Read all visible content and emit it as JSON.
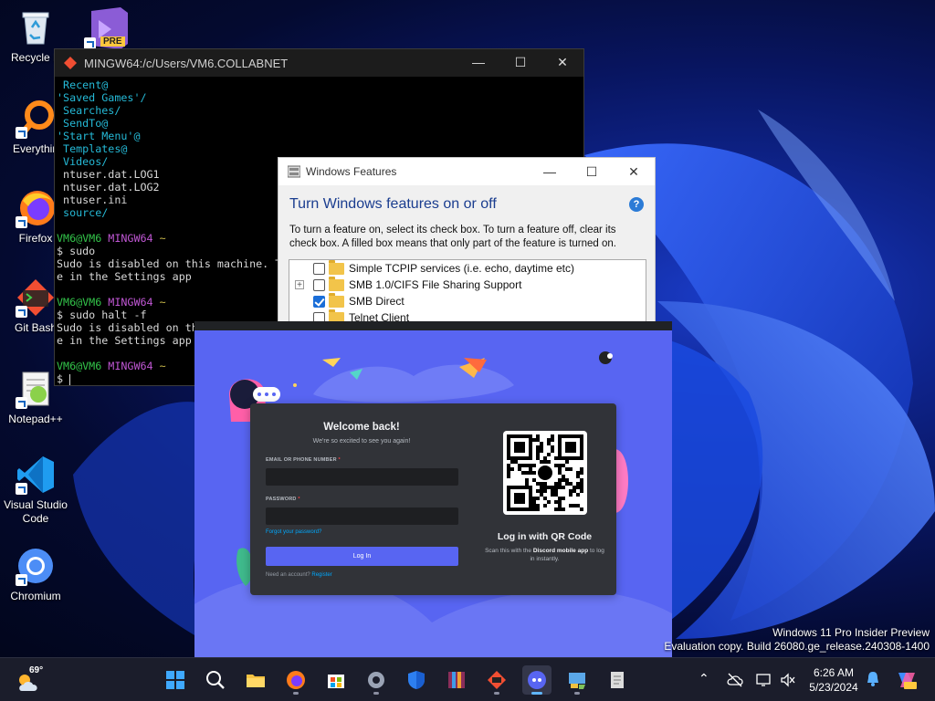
{
  "desktop": {
    "icons": [
      {
        "label": "Recycle B",
        "name": "recycle-bin-icon"
      },
      {
        "label": "Everythin",
        "name": "everything-icon"
      },
      {
        "label": "Firefox",
        "name": "firefox-icon"
      },
      {
        "label": "Git Bash",
        "name": "git-bash-icon"
      },
      {
        "label": "Notepad++",
        "name": "notepad-plus-plus-icon"
      },
      {
        "label": "Visual Studio Code",
        "name": "vscode-icon"
      },
      {
        "label": "Chromium",
        "name": "chromium-icon"
      }
    ],
    "vs_preview_badge": "PRE"
  },
  "terminal": {
    "title": "MINGW64:/c/Users/VM6.COLLABNET",
    "lines": [
      [
        {
          "t": " Recent@",
          "c": "t-cyan"
        }
      ],
      [
        {
          "t": "'Saved Games'/",
          "c": "t-cyan"
        }
      ],
      [
        {
          "t": " Searches/",
          "c": "t-cyan"
        }
      ],
      [
        {
          "t": " SendTo@",
          "c": "t-cyan"
        }
      ],
      [
        {
          "t": "'Start Menu'@",
          "c": "t-cyan"
        }
      ],
      [
        {
          "t": " Templates@",
          "c": "t-cyan"
        }
      ],
      [
        {
          "t": " Videos/",
          "c": "t-cyan"
        }
      ],
      [
        {
          "t": " ntuser.dat.LOG1",
          "c": ""
        }
      ],
      [
        {
          "t": " ntuser.dat.LOG2",
          "c": ""
        }
      ],
      [
        {
          "t": " ntuser.ini",
          "c": ""
        }
      ],
      [
        {
          "t": " source/",
          "c": "t-cyan"
        }
      ],
      [
        {
          "t": "",
          "c": ""
        }
      ],
      [
        {
          "t": "VM6@VM6 ",
          "c": "t-green"
        },
        {
          "t": "MINGW64 ",
          "c": "t-purple"
        },
        {
          "t": "~",
          "c": "t-yellow"
        }
      ],
      [
        {
          "t": "$ sudo",
          "c": ""
        }
      ],
      [
        {
          "t": "Sudo is disabled on this machine. T",
          "c": ""
        }
      ],
      [
        {
          "t": "e in the Settings app",
          "c": ""
        }
      ],
      [
        {
          "t": "",
          "c": ""
        }
      ],
      [
        {
          "t": "VM6@VM6 ",
          "c": "t-green"
        },
        {
          "t": "MINGW64 ",
          "c": "t-purple"
        },
        {
          "t": "~",
          "c": "t-yellow"
        }
      ],
      [
        {
          "t": "$ sudo halt -f",
          "c": ""
        }
      ],
      [
        {
          "t": "Sudo is disabled on th",
          "c": ""
        }
      ],
      [
        {
          "t": "e in the Settings app",
          "c": ""
        }
      ],
      [
        {
          "t": "",
          "c": ""
        }
      ],
      [
        {
          "t": "VM6@VM6 ",
          "c": "t-green"
        },
        {
          "t": "MINGW64 ",
          "c": "t-purple"
        },
        {
          "t": "~",
          "c": "t-yellow"
        }
      ],
      [
        {
          "t": "$ ",
          "c": ""
        }
      ]
    ]
  },
  "features": {
    "title": "Windows Features",
    "heading": "Turn Windows features on or off",
    "help": "?",
    "description": "To turn a feature on, select its check box. To turn a feature off, clear its check box. A filled box means that only part of the feature is turned on.",
    "items": [
      {
        "label": "Simple TCPIP services (i.e. echo, daytime etc)",
        "checked": false,
        "expandable": false
      },
      {
        "label": "SMB 1.0/CIFS File Sharing Support",
        "checked": false,
        "expandable": true
      },
      {
        "label": "SMB Direct",
        "checked": true,
        "expandable": false
      },
      {
        "label": "Telnet Client",
        "checked": false,
        "expandable": false
      }
    ]
  },
  "discord": {
    "welcome": "Welcome back!",
    "subtitle": "We're so excited to see you again!",
    "email_label": "EMAIL OR PHONE NUMBER",
    "password_label": "PASSWORD",
    "required_mark": "*",
    "forgot": "Forgot your password?",
    "login_button": "Log In",
    "need_account": "Need an account?",
    "register": "Register",
    "qr_title": "Log in with QR Code",
    "qr_sub_prefix": "Scan this with the ",
    "qr_sub_app": "Discord mobile app",
    "qr_sub_suffix": " to log in instantly."
  },
  "watermark": {
    "line1": "Windows 11 Pro Insider Preview",
    "line2": "Evaluation copy. Build 26080.ge_release.240308-1400"
  },
  "taskbar": {
    "temperature": "69°",
    "time": "6:26 AM",
    "date": "5/23/2024",
    "apps": [
      {
        "name": "start-button",
        "icon": "windows-logo-icon",
        "active": false,
        "running": false
      },
      {
        "name": "search-button",
        "icon": "search-icon",
        "active": false,
        "running": false
      },
      {
        "name": "taskbar-file-explorer",
        "icon": "folder-icon",
        "active": false,
        "running": false
      },
      {
        "name": "taskbar-firefox",
        "icon": "firefox-icon",
        "active": false,
        "running": true
      },
      {
        "name": "taskbar-microsoft-store",
        "icon": "store-icon",
        "active": false,
        "running": false
      },
      {
        "name": "taskbar-settings",
        "icon": "gear-icon",
        "active": false,
        "running": true
      },
      {
        "name": "taskbar-windows-security",
        "icon": "shield-icon",
        "active": false,
        "running": false
      },
      {
        "name": "taskbar-winrar",
        "icon": "archive-icon",
        "active": false,
        "running": false
      },
      {
        "name": "taskbar-git-bash",
        "icon": "git-icon",
        "active": false,
        "running": true
      },
      {
        "name": "taskbar-discord",
        "icon": "discord-icon",
        "active": true,
        "running": true
      },
      {
        "name": "taskbar-control-panel",
        "icon": "control-panel-icon",
        "active": false,
        "running": true
      },
      {
        "name": "taskbar-notepad",
        "icon": "notepad-icon",
        "active": false,
        "running": false
      }
    ]
  }
}
